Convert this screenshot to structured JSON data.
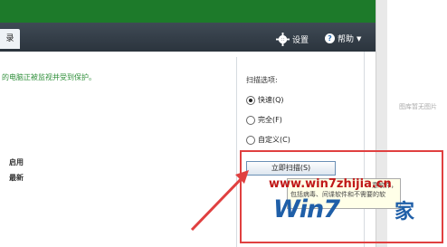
{
  "header": {
    "tab_label": "录",
    "settings_label": "设置",
    "help_label": "帮助"
  },
  "main": {
    "status_text": "的电脑正被监视并受到保护。",
    "rows": [
      {
        "value": "启用"
      },
      {
        "value": "最新"
      }
    ]
  },
  "scan_options": {
    "title": "扫描选项:",
    "options": [
      {
        "label": "快速(Q)",
        "selected": true
      },
      {
        "label": "完全(F)",
        "selected": false
      },
      {
        "label": "自定义(C)",
        "selected": false
      }
    ],
    "scan_button": "立即扫描(S)"
  },
  "tooltip": {
    "line1": "意软件，",
    "line2": "包括病毒、间谍软件和不需要的软"
  },
  "watermark": {
    "url": "www.win7zhijia.cn",
    "logo_text": "Win7",
    "logo_suffix": "家"
  },
  "side": {
    "placeholder": "图库暂无图片"
  },
  "colors": {
    "accent_green": "#1d7a2a",
    "highlight_red": "#e04040",
    "logo_blue": "#1f5fa8"
  }
}
